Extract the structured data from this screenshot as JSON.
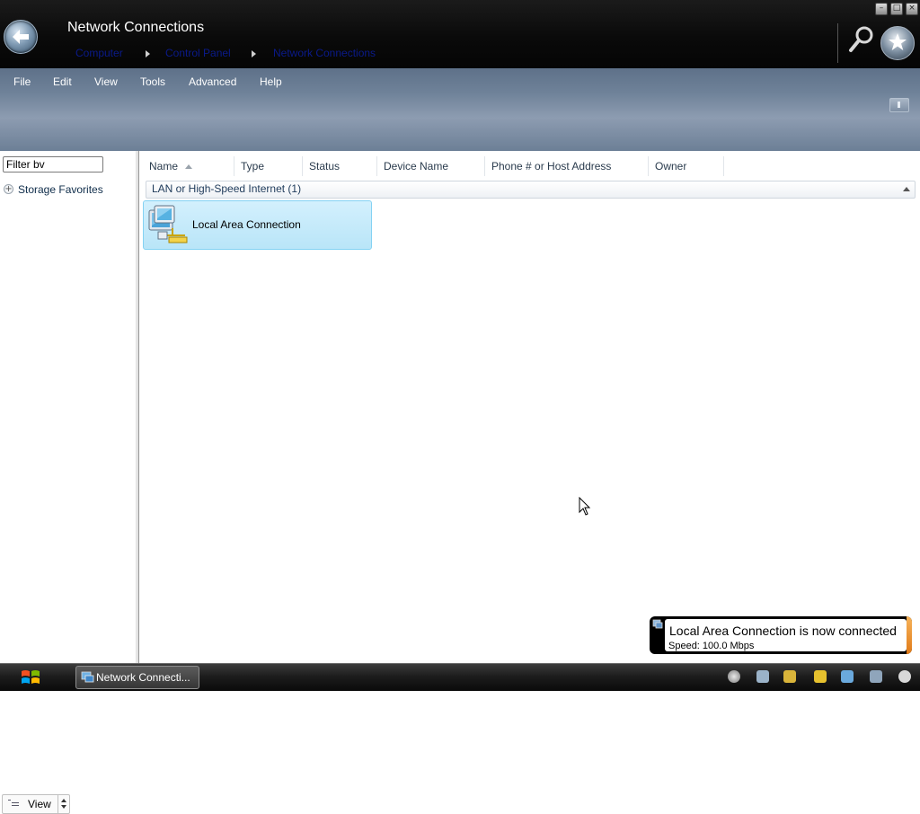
{
  "window": {
    "title": "Network Connections",
    "breadcrumbs": [
      "Computer",
      "Control Panel",
      "Network Connections"
    ]
  },
  "menu": [
    "File",
    "Edit",
    "View",
    "Tools",
    "Advanced",
    "Help"
  ],
  "nav": {
    "filter_value": "Filter bv",
    "items": [
      {
        "label": "Storage Favorites",
        "icon": "plus-expander-icon"
      }
    ],
    "view_label": "View"
  },
  "columns": [
    "Name",
    "Type",
    "Status",
    "Device Name",
    "Phone # or Host Address",
    "Owner"
  ],
  "groups": [
    {
      "label": "LAN or High-Speed Internet (1)",
      "items": [
        {
          "label": "Local Area Connection",
          "icon": "network-connection-icon",
          "selected": true
        }
      ]
    }
  ],
  "notification": {
    "title": "Local Area Connection is now connected",
    "text": "Speed: 100.0 Mbps"
  },
  "taskbar": {
    "task_label": "Network Connecti..."
  },
  "colors": {
    "selection": "#c6ebfb",
    "selection_border": "#84d2f3",
    "menubar": "#7a8ba1",
    "titlebar": "#0a0a0a",
    "notification_accent": "#e98a24"
  }
}
